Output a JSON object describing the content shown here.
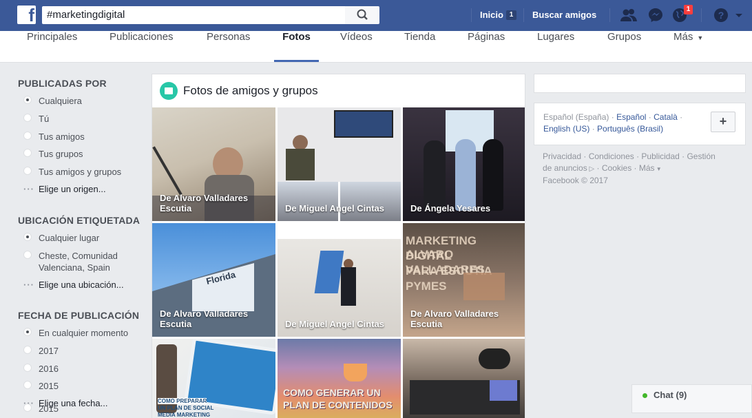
{
  "topbar": {
    "search_value": "#marketingdigital",
    "home_label": "Inicio",
    "home_count": "1",
    "find_friends_label": "Buscar amigos",
    "notification_count": "1"
  },
  "tabs": [
    {
      "label": "Principales"
    },
    {
      "label": "Publicaciones"
    },
    {
      "label": "Personas"
    },
    {
      "label": "Fotos",
      "active": true
    },
    {
      "label": "Vídeos"
    },
    {
      "label": "Tienda"
    },
    {
      "label": "Páginas"
    },
    {
      "label": "Lugares"
    },
    {
      "label": "Grupos"
    },
    {
      "label": "Más"
    }
  ],
  "sidebar": {
    "posted_by": {
      "title": "PUBLICADAS POR",
      "options": [
        "Cualquiera",
        "Tú",
        "Tus amigos",
        "Tus grupos",
        "Tus amigos y grupos"
      ],
      "more": "Elige un origen..."
    },
    "location": {
      "title": "UBICACIÓN ETIQUETADA",
      "options": [
        "Cualquier lugar",
        "Cheste, Comunidad Valenciana, Spain"
      ],
      "more": "Elige una ubicación..."
    },
    "date": {
      "title": "FECHA DE PUBLICACIÓN",
      "options": [
        "En cualquier momento",
        "2017",
        "2016",
        "2015",
        "2015"
      ],
      "more": "Elige una fecha..."
    }
  },
  "main": {
    "title": "Fotos de amigos y grupos",
    "photos": [
      {
        "caption": "De Alvaro Valladares Escutia"
      },
      {
        "caption": "De Miguel Angel Cintas"
      },
      {
        "caption": "De Ángela Yesares"
      },
      {
        "caption": "De Alvaro Valladares Escutia"
      },
      {
        "caption": "De Miguel Angel Cintas"
      },
      {
        "caption": "De Alvaro Valladares Escutia"
      },
      {
        "caption": ""
      },
      {
        "caption": ""
      },
      {
        "caption": ""
      }
    ],
    "photo_texts": {
      "building_sign": "Florida",
      "marketing_line1": "MARKETING ALVARO",
      "marketing_line2": "DIGITAL VALLADARES",
      "marketing_line3": "PARA ESCUTIA",
      "marketing_line4": "PYMES",
      "content_line1": "COMO GENERAR UN",
      "content_line2": "PLAN DE CONTENIDOS",
      "tablet_line1": "COMO PREPARAR",
      "tablet_line2": "UN PLAN DE SOCIAL",
      "tablet_line3": "MEDIA MARKETING"
    }
  },
  "right": {
    "languages": [
      {
        "label": "Español (España)",
        "current": true
      },
      {
        "label": "Español"
      },
      {
        "label": "Català"
      },
      {
        "label": "English (US)"
      },
      {
        "label": "Português (Brasil)"
      }
    ],
    "add_language": "+",
    "footer_links": [
      "Privacidad",
      "Condiciones",
      "Publicidad",
      "Gestión de anuncios",
      "Cookies",
      "Más"
    ],
    "copyright": "Facebook © 2017"
  },
  "chat": {
    "label": "Chat (9)"
  },
  "colors": {
    "brand": "#3b5998",
    "online": "#42b72a",
    "badge": "#fa3e3e"
  }
}
